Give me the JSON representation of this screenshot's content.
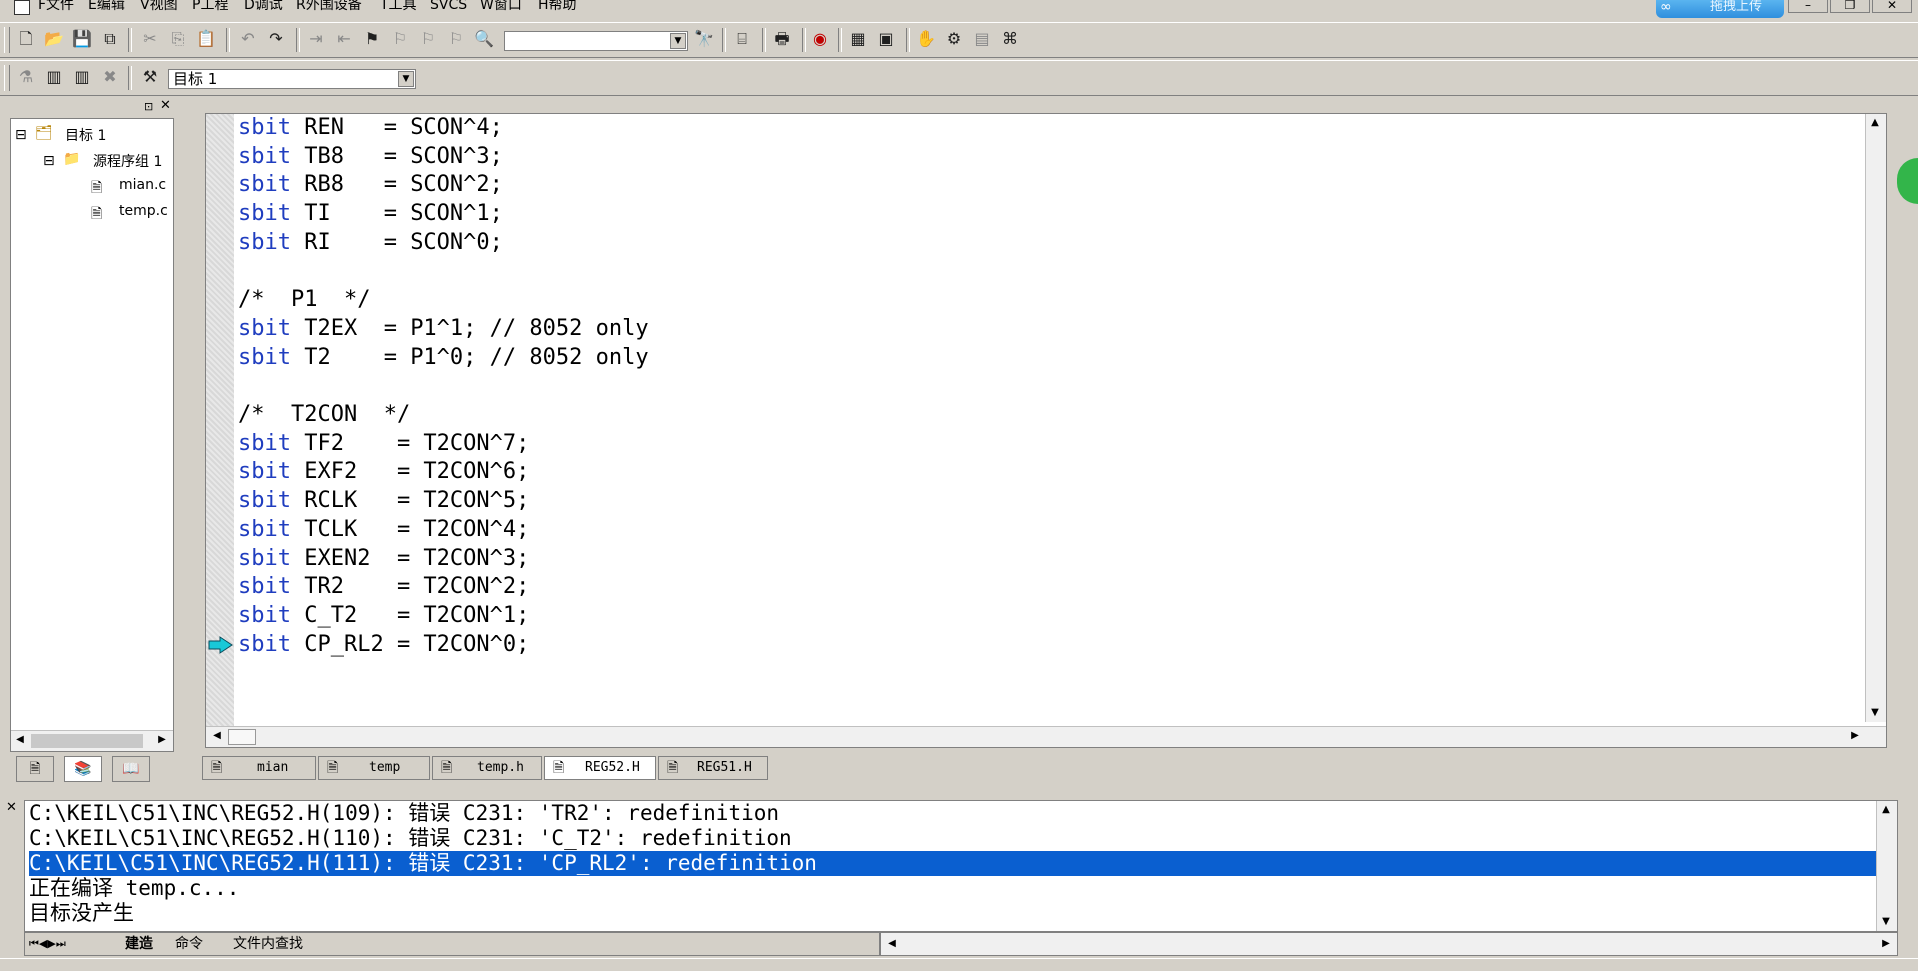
{
  "menubar": {
    "items": [
      "F文件",
      "E编辑",
      "V视图",
      "P工程",
      "D调试",
      "R外围设备",
      "T工具",
      "SVCS",
      "W窗口",
      "H帮助"
    ],
    "upload_label": "拖拽上传"
  },
  "toolbar2": {
    "target_combo_value": "目标 1"
  },
  "project": {
    "root_label": "目标 1",
    "group_label": "源程序组 1",
    "files": [
      "mian.c",
      "temp.c"
    ]
  },
  "editor": {
    "lines": [
      {
        "kw": "sbit",
        "rest": " REN   = SCON^4;"
      },
      {
        "kw": "sbit",
        "rest": " TB8   = SCON^3;"
      },
      {
        "kw": "sbit",
        "rest": " RB8   = SCON^2;"
      },
      {
        "kw": "sbit",
        "rest": " TI    = SCON^1;"
      },
      {
        "kw": "sbit",
        "rest": " RI    = SCON^0;"
      },
      {
        "kw": "",
        "rest": ""
      },
      {
        "kw": "",
        "rest": "/*  P1  */"
      },
      {
        "kw": "sbit",
        "rest": " T2EX  = P1^1; // 8052 only"
      },
      {
        "kw": "sbit",
        "rest": " T2    = P1^0; // 8052 only"
      },
      {
        "kw": "",
        "rest": ""
      },
      {
        "kw": "",
        "rest": "/*  T2CON  */"
      },
      {
        "kw": "sbit",
        "rest": " TF2    = T2CON^7;"
      },
      {
        "kw": "sbit",
        "rest": " EXF2   = T2CON^6;"
      },
      {
        "kw": "sbit",
        "rest": " RCLK   = T2CON^5;"
      },
      {
        "kw": "sbit",
        "rest": " TCLK   = T2CON^4;"
      },
      {
        "kw": "sbit",
        "rest": " EXEN2  = T2CON^3;"
      },
      {
        "kw": "sbit",
        "rest": " TR2    = T2CON^2;"
      },
      {
        "kw": "sbit",
        "rest": " C_T2   = T2CON^1;"
      },
      {
        "kw": "sbit",
        "rest": " CP_RL2 = T2CON^0;"
      }
    ]
  },
  "file_tabs": [
    {
      "label": "mian",
      "active": false
    },
    {
      "label": "temp",
      "active": false
    },
    {
      "label": "temp.h",
      "active": false
    },
    {
      "label": "REG52.H",
      "active": true
    },
    {
      "label": "REG51.H",
      "active": false
    }
  ],
  "output": {
    "lines": [
      {
        "text": "C:\\KEIL\\C51\\INC\\REG52.H(109): 错误 C231: 'TR2': redefinition",
        "selected": false
      },
      {
        "text": "C:\\KEIL\\C51\\INC\\REG52.H(110): 错误 C231: 'C_T2': redefinition",
        "selected": false
      },
      {
        "text": "C:\\KEIL\\C51\\INC\\REG52.H(111): 错误 C231: 'CP_RL2': redefinition",
        "selected": true
      },
      {
        "text": "正在编译 temp.c...",
        "selected": false
      },
      {
        "text": "目标没产生",
        "selected": false
      }
    ],
    "tabs": [
      "建造",
      "命令",
      "文件内查找"
    ]
  },
  "colors": {
    "keyword": "#1f3dbf",
    "selection": "#0a5fd0",
    "chrome": "#d4d0c8",
    "arrow": "#19c8d8"
  }
}
